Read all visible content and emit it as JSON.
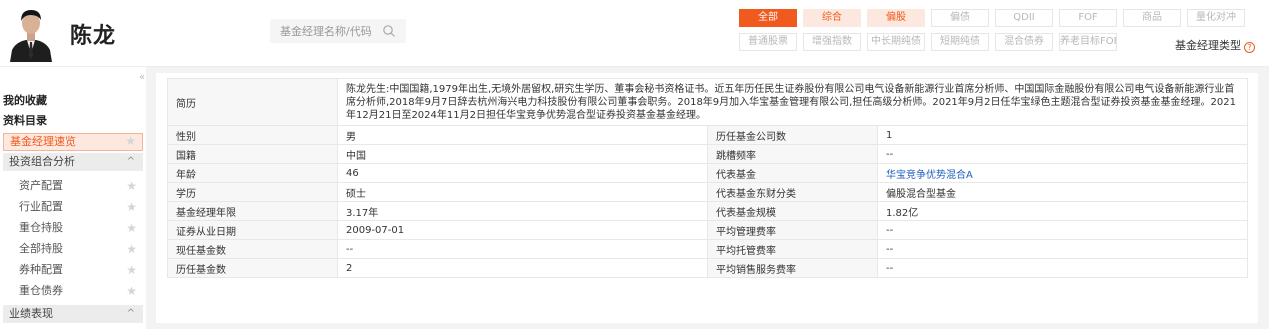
{
  "header": {
    "manager_name": "陈龙",
    "search_placeholder": "基金经理名称/代码",
    "filters_row1": [
      "全部",
      "综合",
      "偏股",
      "偏债",
      "QDII",
      "FOF",
      "商品",
      "量化对冲"
    ],
    "filters_row2": [
      "普通股票",
      "增强指数",
      "中长期纯债",
      "短期纯债",
      "混合债券",
      "养老目标FOF"
    ],
    "type_label": "基金经理类型",
    "help_icon": "?"
  },
  "sidebar": {
    "collapse_icon": "«",
    "favorites": "我的收藏",
    "catalog": "资料目录",
    "items": [
      {
        "label": "基金经理速览"
      },
      {
        "label": "投资组合分析",
        "chevron": "^"
      },
      {
        "label": "资产配置"
      },
      {
        "label": "行业配置"
      },
      {
        "label": "重仓持股"
      },
      {
        "label": "全部持股"
      },
      {
        "label": "券种配置"
      },
      {
        "label": "重仓债券"
      },
      {
        "label": "业绩表现",
        "chevron": "^"
      }
    ],
    "star": "★"
  },
  "profile": {
    "bio_label": "简历",
    "bio": "陈龙先生:中国国籍,1979年出生,无境外居留权,研究生学历、董事会秘书资格证书。近五年历任民生证券股份有限公司电气设备新能源行业首席分析师、中国国际金融股份有限公司电气设备新能源行业首席分析师,2018年9月7日辞去杭州海兴电力科技股份有限公司董事会职务。2018年9月加入华宝基金管理有限公司,担任高级分析师。2021年9月2日任华宝绿色主题混合型证券投资基金基金经理。2021年12月21日至2024年11月2日担任华宝竞争优势混合型证券投资基金基金经理。",
    "rows": [
      {
        "l1": "性别",
        "v1": "男",
        "l2": "历任基金公司数",
        "v2": "1"
      },
      {
        "l1": "国籍",
        "v1": "中国",
        "l2": "跳槽频率",
        "v2": "--"
      },
      {
        "l1": "年龄",
        "v1": "46",
        "l2": "代表基金",
        "v2": "华宝竞争优势混合A"
      },
      {
        "l1": "学历",
        "v1": "硕士",
        "l2": "代表基金东财分类",
        "v2": "偏股混合型基金"
      },
      {
        "l1": "基金经理年限",
        "v1": "3.17年",
        "l2": "代表基金规模",
        "v2": "1.82亿"
      },
      {
        "l1": "证券从业日期",
        "v1": "2009-07-01",
        "l2": "平均管理费率",
        "v2": "--"
      },
      {
        "l1": "现任基金数",
        "v1": "--",
        "l2": "平均托管费率",
        "v2": "--"
      },
      {
        "l1": "历任基金数",
        "v1": "2",
        "l2": "平均销售服务费率",
        "v2": "--"
      }
    ]
  },
  "colors": {
    "accent": "#f05a1e",
    "accent_light": "#fde8df",
    "link": "#1f5fbf"
  }
}
